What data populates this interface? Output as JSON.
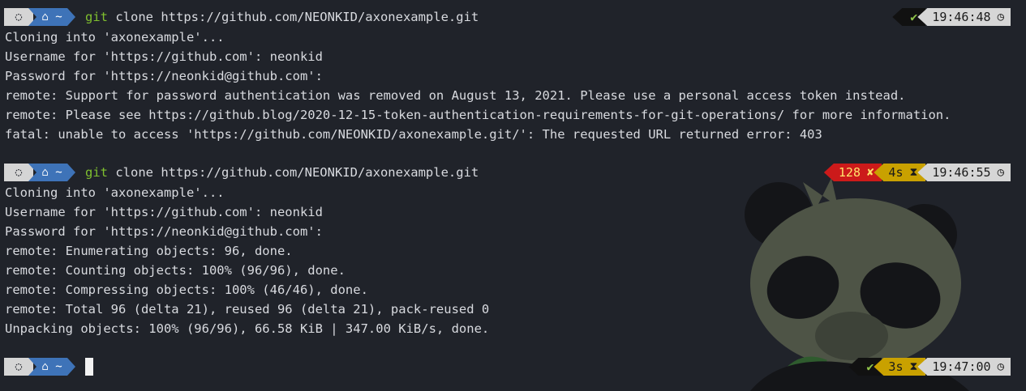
{
  "prompt": {
    "os_glyph": "◌",
    "dir_glyph": "⌂ ~"
  },
  "blocks": [
    {
      "command_kw": "git",
      "command_rest": " clone https://github.com/NEONKID/axonexample.git",
      "status_glyph": "✔",
      "time": "19:46:48",
      "output": [
        "Cloning into 'axonexample'...",
        "Username for 'https://github.com': neonkid",
        "Password for 'https://neonkid@github.com':",
        "remote: Support for password authentication was removed on August 13, 2021. Please use a personal access token instead.",
        "remote: Please see https://github.blog/2020-12-15-token-authentication-requirements-for-git-operations/ for more information.",
        "fatal: unable to access 'https://github.com/NEONKID/axonexample.git/': The requested URL returned error: 403"
      ]
    },
    {
      "command_kw": "git",
      "command_rest": " clone https://github.com/NEONKID/axonexample.git",
      "exit_code": "128",
      "error_glyph": "✘",
      "duration": "4s",
      "time": "19:46:55",
      "output": [
        "Cloning into 'axonexample'...",
        "Username for 'https://github.com': neonkid",
        "Password for 'https://neonkid@github.com':",
        "remote: Enumerating objects: 96, done.",
        "remote: Counting objects: 100% (96/96), done.",
        "remote: Compressing objects: 100% (46/46), done.",
        "remote: Total 96 (delta 21), reused 96 (delta 21), pack-reused 0",
        "Unpacking objects: 100% (96/96), 66.58 KiB | 347.00 KiB/s, done."
      ]
    },
    {
      "status_glyph": "✔",
      "duration": "3s",
      "time": "19:47:00"
    }
  ],
  "icons": {
    "os": "linux-logo-icon",
    "home": "home-icon",
    "hourglass": "hourglass-icon",
    "clock": "clock-icon",
    "success": "check-icon",
    "error": "cross-icon"
  },
  "colors": {
    "background": "#20232a",
    "text": "#d8dadf",
    "git_keyword": "#7fbf2f",
    "dir_segment": "#3e73b8",
    "error_segment": "#cc1a1a",
    "duration_segment": "#c9a100",
    "time_segment": "#d6d6d6"
  }
}
